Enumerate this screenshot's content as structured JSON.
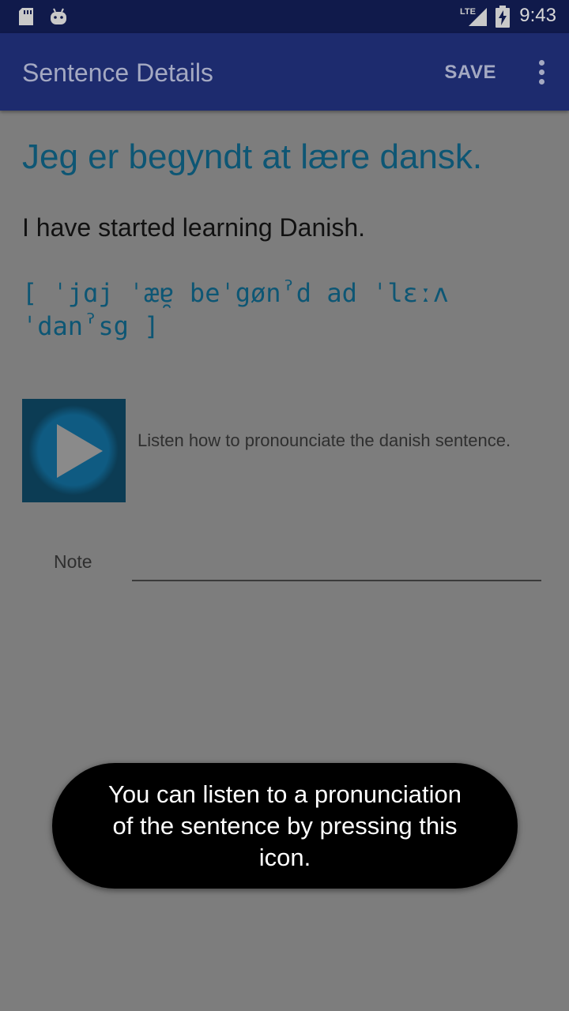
{
  "status_bar": {
    "time": "9:43",
    "network_label": "LTE",
    "icons": [
      "sd-card-icon",
      "android-icon",
      "lte-signal-icon",
      "battery-charging-icon"
    ]
  },
  "app_bar": {
    "title": "Sentence Details",
    "save_label": "SAVE",
    "overflow_icon": "overflow-menu-icon"
  },
  "sentence": {
    "danish": "Jeg er begyndt at lære dansk.",
    "english": "I have started learning Danish.",
    "ipa_line1": "[ ˈjɑj ˈæɐ̯ beˈgønˀd ad ˈlɛːʌ",
    "ipa_line2": "ˈdanˀsg ]"
  },
  "audio": {
    "play_icon": "play-icon",
    "description": "Listen how to pronounciate the danish sentence."
  },
  "note": {
    "label": "Note",
    "value": ""
  },
  "toast": {
    "message": "You can listen to a pronunciation of the sentence by pressing this icon."
  },
  "colors": {
    "scrim_background": "#7d7d7d",
    "status_bar": "#101a4b",
    "app_bar": "#1d2b6e",
    "danish_text": "#0d5674",
    "play_button_bg": "#0c3c54",
    "play_circle": "#0f5b82",
    "toast_bg": "#000000"
  }
}
